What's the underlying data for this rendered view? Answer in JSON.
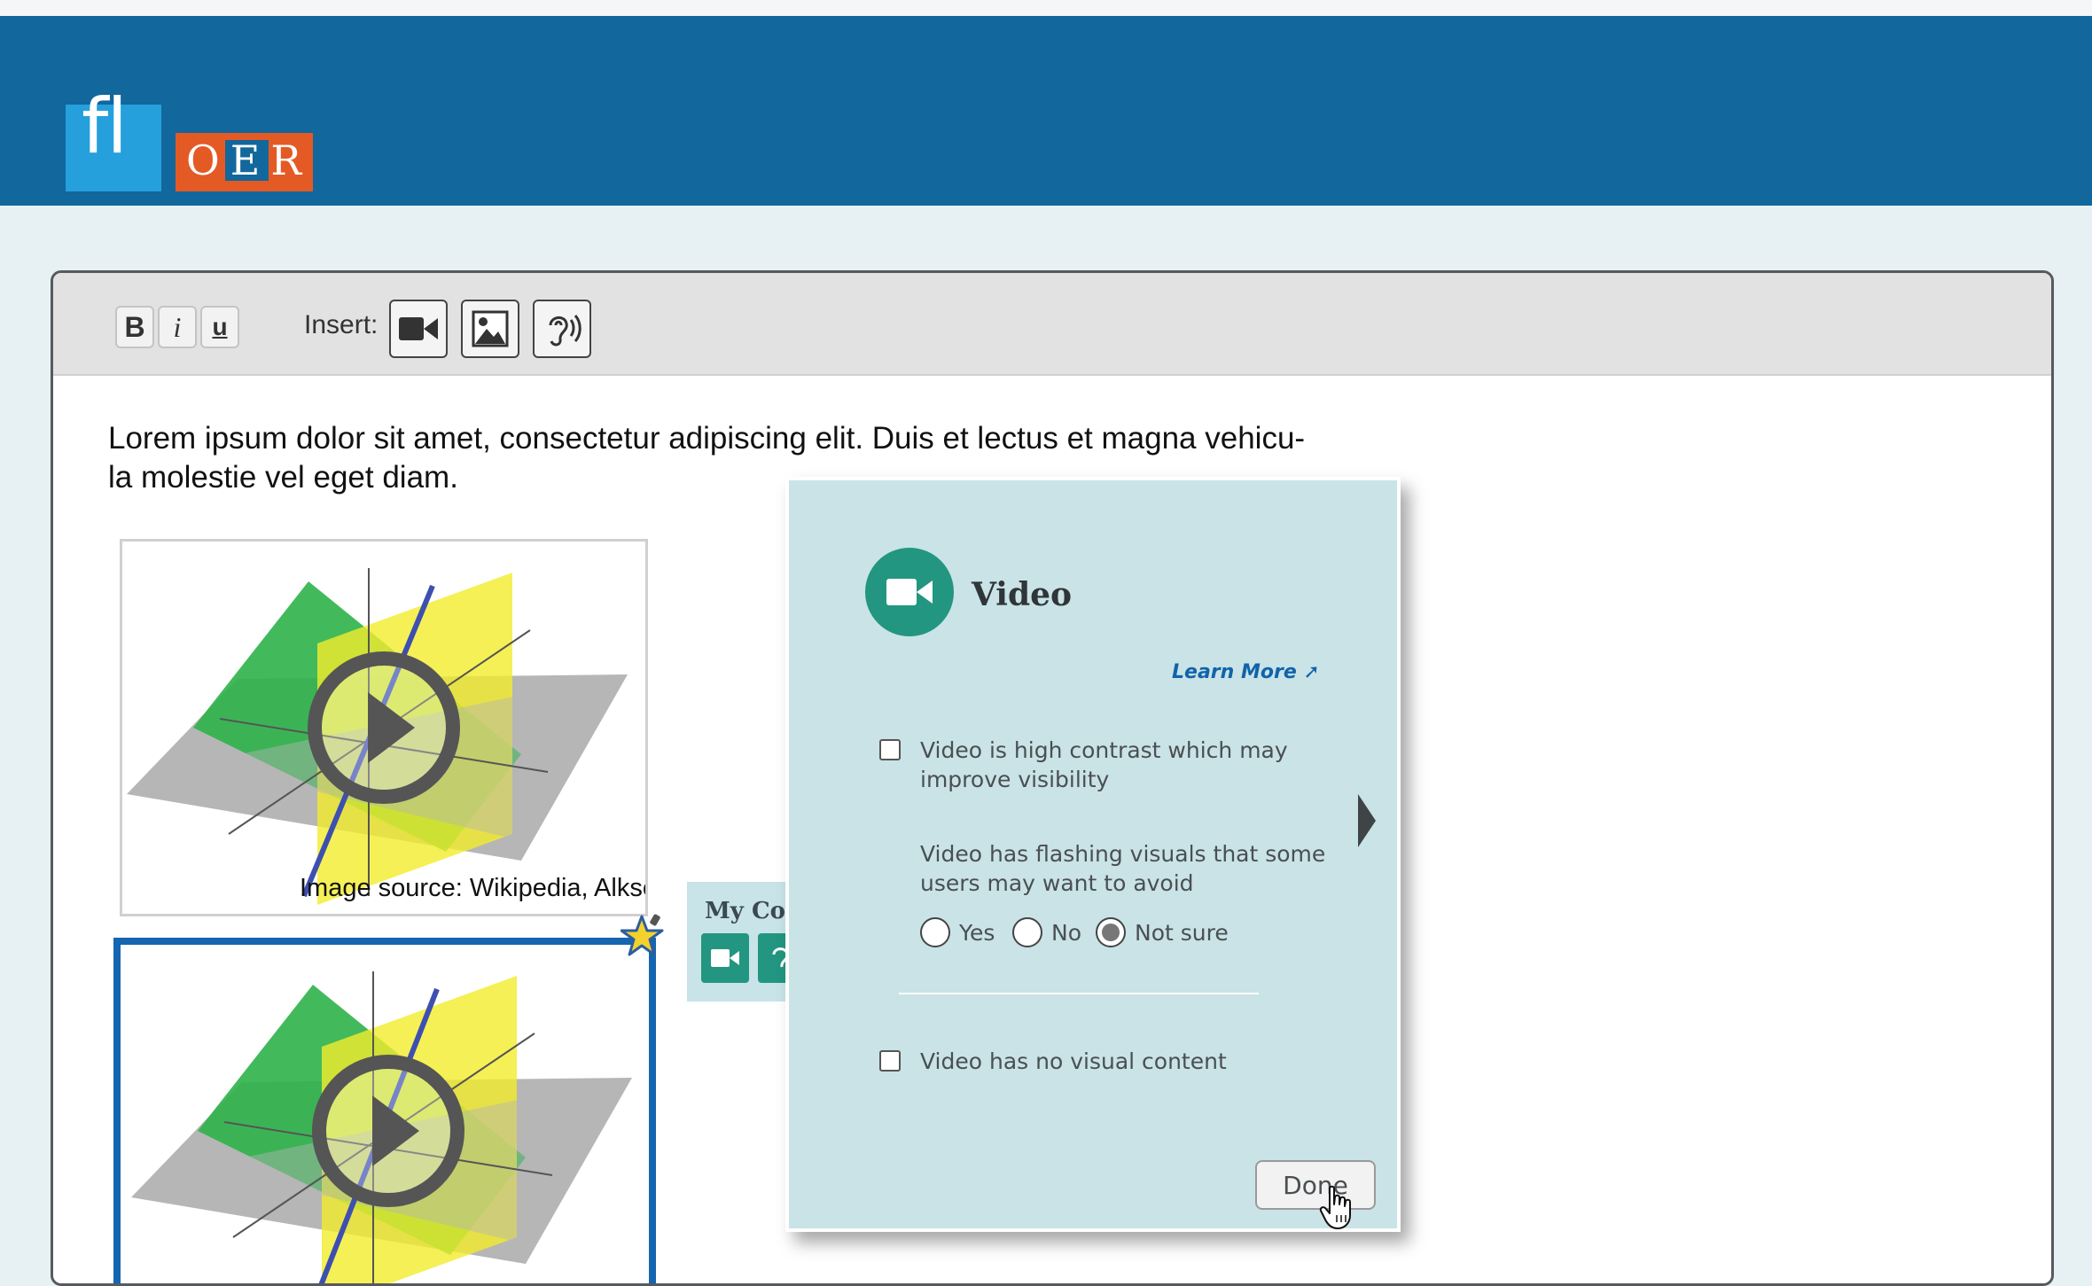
{
  "app": {
    "logo": {
      "fl": "fl",
      "oer": [
        "O",
        "E",
        "R"
      ]
    }
  },
  "toolbar": {
    "bold_label": "B",
    "italic_label": "i",
    "underline_label": "u",
    "insert_label": "Insert:",
    "insert_buttons": [
      "video-camera-icon",
      "image-icon",
      "ear-icon"
    ]
  },
  "content": {
    "paragraph": "Lorem ipsum dolor sit amet, consectetur adipiscing elit. Duis et lectus et magna vehicu-la molestie vel eget diam.",
    "paragraph_line1": "Lorem ipsum dolor sit amet, consectetur adipiscing elit. Duis et lectus et magna vehicu-",
    "paragraph_line2": "la molestie vel eget diam.",
    "image_caption": "Image source: Wikipedia, Alksentrs"
  },
  "my_content": {
    "label": "My Cor"
  },
  "panel": {
    "title": "Video",
    "learn_more": "Learn More",
    "option1": "Video is high contrast which may improve visibility",
    "question": "Video has flashing visuals that some users may want to avoid",
    "radio_options": [
      "Yes",
      "No",
      "Not sure"
    ],
    "radio_selected": "Not sure",
    "option2": "Video has no visual content",
    "done_label": "Done"
  },
  "colors": {
    "header": "#12679c",
    "logo_blue": "#25a0dd",
    "logo_orange": "#e45a25",
    "accent_teal": "#229680",
    "panel_bg": "#c9e3e7",
    "link_blue": "#1263a9",
    "selection_border": "#1466b0"
  }
}
